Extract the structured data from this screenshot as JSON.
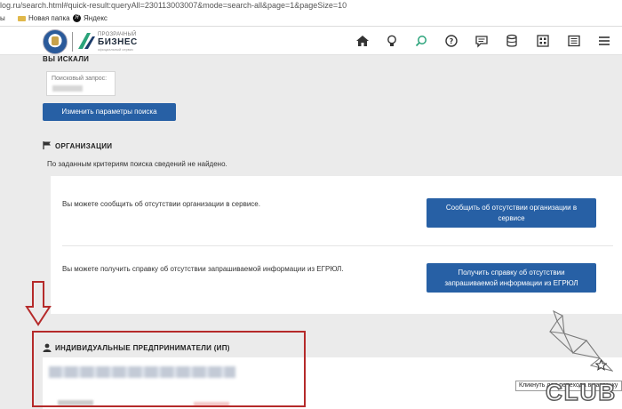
{
  "browser": {
    "url": "log.ru/search.html#quick-result:queryAll=230113003007&mode=search-all&page=1&pageSize=10",
    "bookmarks": [
      {
        "label": "ы"
      },
      {
        "label": "Новая папка"
      },
      {
        "label": "Яндекс"
      }
    ]
  },
  "header": {
    "logo_small": "ПРОЗРАЧНЫЙ",
    "logo_big": "БИЗНЕС",
    "logo_tiny": "официальный сервис",
    "nav_icons": [
      "home-icon",
      "lightbulb-icon",
      "search-icon",
      "help-icon",
      "chat-icon",
      "database-icon",
      "grid-icon",
      "document-icon",
      "menu-icon"
    ],
    "accent_color": "#2760a5"
  },
  "search": {
    "title": "ВЫ ИСКАЛИ",
    "query_label": "Поисковый запрос:",
    "change_button": "Изменить параметры поиска"
  },
  "organizations": {
    "title": "ОРГАНИЗАЦИИ",
    "not_found": "По заданным критериям поиска сведений не найдено.",
    "report_text": "Вы можете сообщить об отсутствии организации в сервисе.",
    "report_button": "Сообщить об отсутствии организации в сервисе",
    "certificate_text": "Вы можете получить справку об отсутствии запрашиваемой информации из ЕГРЮЛ.",
    "certificate_button": "Получить справку об отсутствии запрашиваемой информации из ЕГРЮЛ"
  },
  "entrepreneurs": {
    "title": "ИНДИВИДУАЛЬНЫЕ ПРЕДПРИНИМАТЕЛИ (ИП)",
    "tag_label": "ИНН:"
  },
  "tooltip": "Кликнуть для перехода в карточку",
  "watermark": "CLUB"
}
